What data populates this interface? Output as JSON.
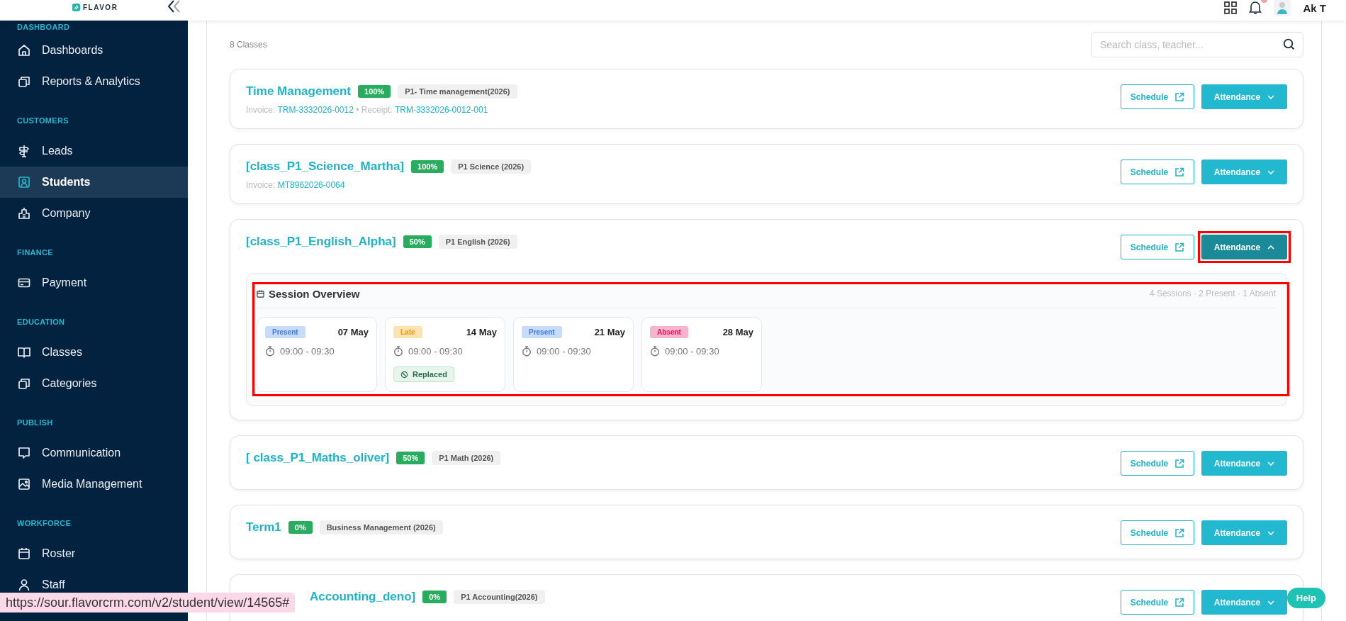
{
  "topbar": {
    "logo": "FLAVOR",
    "user_name": "Ak T"
  },
  "sidebar": {
    "sections": [
      {
        "label": "DASHBOARD",
        "items": [
          {
            "label": "Dashboards",
            "selected": false
          },
          {
            "label": "Reports & Analytics",
            "selected": false
          }
        ]
      },
      {
        "label": "CUSTOMERS",
        "items": [
          {
            "label": "Leads",
            "selected": false
          },
          {
            "label": "Students",
            "selected": true
          },
          {
            "label": "Company",
            "selected": false
          }
        ]
      },
      {
        "label": "FINANCE",
        "items": [
          {
            "label": "Payment",
            "selected": false
          }
        ]
      },
      {
        "label": "EDUCATION",
        "items": [
          {
            "label": "Classes",
            "selected": false
          },
          {
            "label": "Categories",
            "selected": false
          }
        ]
      },
      {
        "label": "PUBLISH",
        "items": [
          {
            "label": "Communication",
            "selected": false
          },
          {
            "label": "Media Management",
            "selected": false
          }
        ]
      },
      {
        "label": "WORKFORCE",
        "items": [
          {
            "label": "Roster",
            "selected": false
          },
          {
            "label": "Staff",
            "selected": false
          }
        ]
      }
    ]
  },
  "count_label": "8 Classes",
  "search": {
    "placeholder": "Search class, teacher..."
  },
  "classes": [
    {
      "title": "Time Management",
      "progress": "100%",
      "course": "P1- Time management(2026)",
      "meta": [
        {
          "kind": "text",
          "text": "Invoice:"
        },
        {
          "kind": "link",
          "text": "TRM-3332026-0012"
        },
        {
          "kind": "text",
          "text": "• Receipt:"
        },
        {
          "kind": "link",
          "text": "TRM-3332026-0012-001"
        }
      ],
      "schedule_label": "Schedule",
      "attendance_label": "Attendance",
      "expanded": false,
      "annotated": false
    },
    {
      "title": "[class_P1_Science_Martha]",
      "progress": "100%",
      "course": "P1 Science (2026)",
      "meta": [
        {
          "kind": "text",
          "text": "Invoice:"
        },
        {
          "kind": "link",
          "text": "MT8962026-0064"
        }
      ],
      "schedule_label": "Schedule",
      "attendance_label": "Attendance",
      "expanded": false,
      "annotated": false
    },
    {
      "title": "[class_P1_English_Alpha]",
      "progress": "50%",
      "course": "P1 English (2026)",
      "schedule_label": "Schedule",
      "attendance_label": "Attendance",
      "expanded": true,
      "annotated": true,
      "session_overview": {
        "title": "Session Overview",
        "summary": "4 Sessions · 2 Present · 1 Absent",
        "annotated": true,
        "sessions": [
          {
            "status": "Present",
            "kind": "present",
            "date": "07 May",
            "time": "09:00 - 09:30"
          },
          {
            "status": "Late",
            "kind": "late",
            "date": "14 May",
            "time": "09:00 - 09:30",
            "badge": "Replaced"
          },
          {
            "status": "Present",
            "kind": "present",
            "date": "21 May",
            "time": "09:00 - 09:30"
          },
          {
            "status": "Absent",
            "kind": "absent",
            "date": "28 May",
            "time": "09:00 - 09:30"
          }
        ]
      }
    },
    {
      "title": "[ class_P1_Maths_oliver]",
      "progress": "50%",
      "course": "P1 Math (2026)",
      "schedule_label": "Schedule",
      "attendance_label": "Attendance",
      "expanded": false,
      "annotated": false
    },
    {
      "title": "Term1",
      "progress": "0%",
      "course": "Business Management (2026)",
      "schedule_label": "Schedule",
      "attendance_label": "Attendance",
      "expanded": false,
      "annotated": false
    },
    {
      "title": "Accounting_deno]",
      "progress": "0%",
      "course": "P1 Accounting(2026)",
      "schedule_label": "Schedule",
      "attendance_label": "Attendance",
      "expanded": false,
      "annotated": false
    }
  ],
  "status_url": "https://sour.flavorcrm.com/v2/student/view/14565#",
  "help_label": "Help"
}
